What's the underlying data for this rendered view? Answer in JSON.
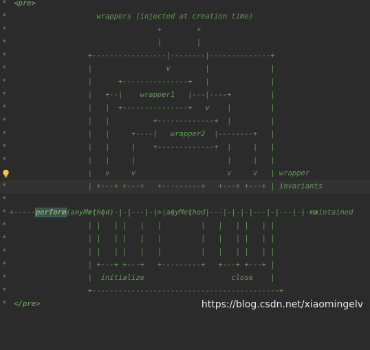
{
  "editor": {
    "lines": [
      {
        "star": "*",
        "text": " <pre>"
      },
      {
        "star": "*",
        "text": "                    wrappers (injected at creation time)"
      },
      {
        "star": "*",
        "text": "                                  +        +"
      },
      {
        "star": "*",
        "text": "                                  |        |"
      },
      {
        "star": "*",
        "text": "                  +-----------------|--------|--------------+"
      },
      {
        "star": "*",
        "text": "                  |                 v        |              |"
      },
      {
        "star": "*",
        "text": "                  |      +---------------+   |              |"
      },
      {
        "star": "*",
        "text": "                  |   +--|    wrapper1   |---|----+         |"
      },
      {
        "star": "*",
        "text": "                  |   |  +---------------+   v    |         |"
      },
      {
        "star": "*",
        "text": "                  |   |          +-------------+  |         |"
      },
      {
        "star": "*",
        "text": "                  |   |     +----|   wrapper2  |--------+   |"
      },
      {
        "star": "*",
        "text": "                  |   |     |    +-------------+  |     |   |"
      },
      {
        "star": "*",
        "text": "                  |   |     |                     |     |   |"
      },
      {
        "star": "",
        "text": "                  |   v     v                     v     v   | wrapper"
      },
      {
        "star": "*",
        "text": "                  | +---+ +---+   +---------+   +---+ +---+ | invariants"
      },
      {
        "star": "*",
        "text": "(anyMethod) | |   | |   |   |         |   |   | |   | | maintained"
      },
      {
        "star": "*",
        "text": "+----------------->|-|---|-|---|-->|anyMethod|---|---|-|---|-|-------->"
      },
      {
        "star": "*",
        "text": "                  | |   | |   |   |         |   |   | |   | |"
      },
      {
        "star": "*",
        "text": "                  | |   | |   |   |         |   |   | |   | |"
      },
      {
        "star": "*",
        "text": "                  | |   | |   |   |         |   |   | |   | |"
      },
      {
        "star": "*",
        "text": "                  | +---+ +---+   +---------+   +---+ +---+ |"
      },
      {
        "star": "*",
        "text": "                  |  initialize                    close    |"
      },
      {
        "star": "*",
        "text": "                  +-------------------------------------------+"
      },
      {
        "star": "*",
        "text": " </pre>"
      }
    ],
    "perform_token": "perform",
    "watermark": "https://blog.csdn.net/xiaomingelv"
  }
}
